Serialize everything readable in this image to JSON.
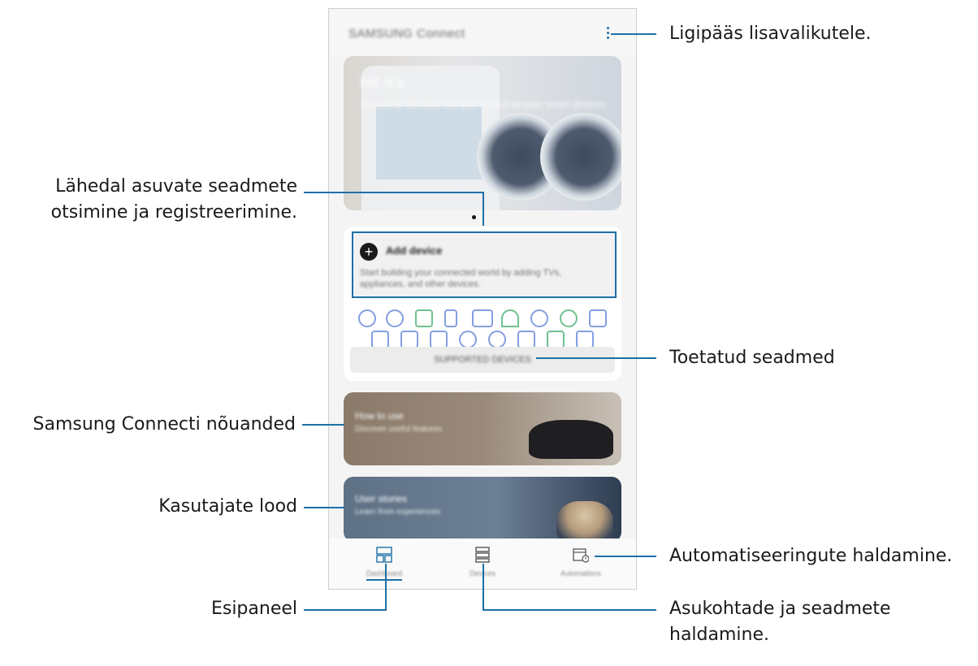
{
  "app": {
    "title": "SAMSUNG Connect",
    "hero_heading": "Hi! It's",
    "hero_subtitle": "Samsung Connect lets you control all your smart devices"
  },
  "add_device": {
    "title": "Add device",
    "description": "Start building your connected world by adding TVs, appliances, and other devices."
  },
  "supported_devices_button": "SUPPORTED DEVICES",
  "tips_card": {
    "title": "How to use",
    "subtitle": "Discover useful features"
  },
  "stories_card": {
    "title": "User stories",
    "subtitle": "Learn from experiences"
  },
  "bottom_tabs": [
    {
      "label": "Dashboard",
      "icon": "dashboard-icon",
      "active": true
    },
    {
      "label": "Devices",
      "icon": "devices-list-icon",
      "active": false
    },
    {
      "label": "Automations",
      "icon": "automations-icon",
      "active": false
    }
  ],
  "callouts": {
    "more_options": "Ligipääs lisavalikutele.",
    "nearby_devices_line1": "Lähedal asuvate seadmete",
    "nearby_devices_line2": "otsimine ja registreerimine.",
    "supported_devices": "Toetatud seadmed",
    "tips": "Samsung Connecti nõuanded",
    "user_stories": "Kasutajate lood",
    "automations": "Automatiseeringute haldamine.",
    "dashboard": "Esipaneel",
    "locations_line1": "Asukohtade ja seadmete",
    "locations_line2": "haldamine."
  },
  "colors": {
    "callout_line": "#1e6fa8",
    "accent": "#1e6fa8"
  }
}
